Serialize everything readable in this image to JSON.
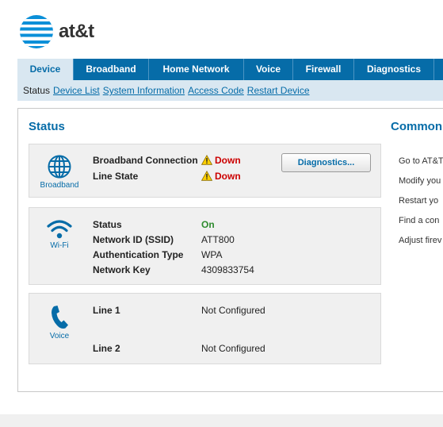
{
  "brand": {
    "name": "at&t"
  },
  "nav": {
    "tabs": [
      {
        "label": "Device",
        "active": true
      },
      {
        "label": "Broadband"
      },
      {
        "label": "Home Network"
      },
      {
        "label": "Voice"
      },
      {
        "label": "Firewall"
      },
      {
        "label": "Diagnostics"
      }
    ]
  },
  "subnav": {
    "current": "Status",
    "links": [
      "Device List",
      "System Information",
      "Access Code",
      "Restart Device"
    ]
  },
  "status": {
    "title": "Status",
    "broadband": {
      "caption": "Broadband",
      "connection_label": "Broadband Connection",
      "connection_value": "Down",
      "line_state_label": "Line State",
      "line_state_value": "Down",
      "diagnostics_button": "Diagnostics..."
    },
    "wifi": {
      "caption": "Wi-Fi",
      "status_label": "Status",
      "status_value": "On",
      "ssid_label": "Network ID (SSID)",
      "ssid_value": "ATT800",
      "auth_label": "Authentication Type",
      "auth_value": "WPA",
      "key_label": "Network Key",
      "key_value": "4309833754"
    },
    "voice": {
      "caption": "Voice",
      "line1_label": "Line 1",
      "line1_value": "Not Configured",
      "line2_label": "Line 2",
      "line2_value": "Not Configured"
    }
  },
  "common": {
    "title": "Common",
    "items": [
      "Go to AT&T",
      "Modify you",
      "Restart yo",
      "Find a con",
      "Adjust firev"
    ]
  },
  "colors": {
    "accent": "#066ca8",
    "down": "#cc0000",
    "on": "#2e8b2e",
    "warning": "#ffd000"
  }
}
